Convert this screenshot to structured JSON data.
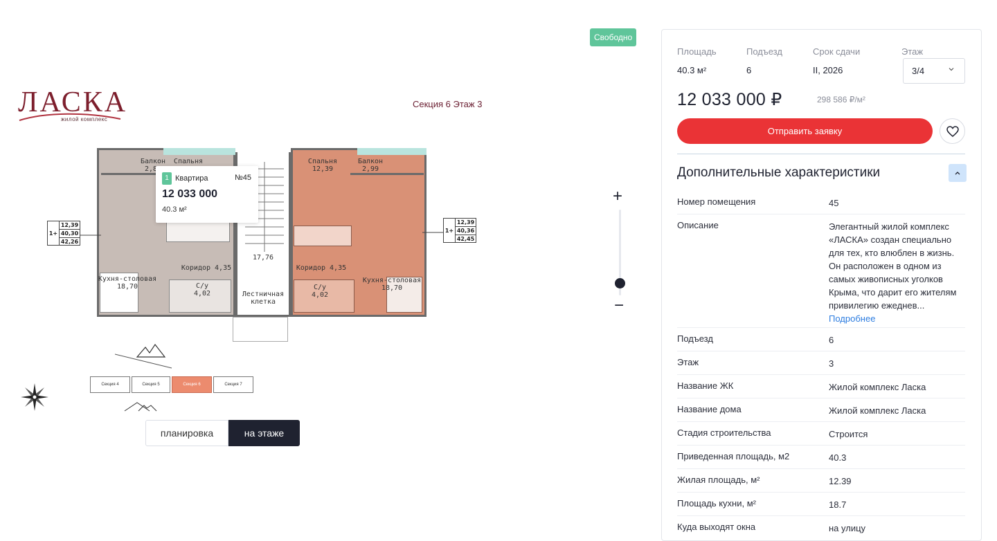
{
  "status": "Свободно",
  "logo": {
    "name": "ЛАСКА",
    "subtitle": "жилой комплекс"
  },
  "section_label": "Секция 6 Этаж 3",
  "plan": {
    "rooms_left": {
      "balcony": "Балкон\n2,80",
      "bedroom": "Спальня",
      "corridor": "Коридор 4,35",
      "kitchen": "Кухня-столовая\n18,70",
      "bath": "С/у\n4,02"
    },
    "rooms_center": {
      "hall_area": "17,76",
      "stairs": "Лестничная\nклетка"
    },
    "rooms_right": {
      "bedroom": "Спальня\n12,39",
      "balcony": "Балкон\n2,99",
      "corridor": "Коридор 4,35",
      "kitchen": "Кухня-столовая\n18,70",
      "bath": "С/у\n4,02"
    },
    "tag_left": {
      "rooms": "1+",
      "values": [
        "12,39",
        "40,30",
        "42,26"
      ]
    },
    "tag_right": {
      "rooms": "1+",
      "values": [
        "12,39",
        "40,36",
        "42,45"
      ]
    }
  },
  "popover": {
    "rooms": "1",
    "type": "Квартира",
    "number": "№45",
    "price": "12 033 000",
    "area": "40.3 м²"
  },
  "zoom": {
    "plus": "+",
    "minus": "−",
    "level": 0.18
  },
  "sections": [
    {
      "label": "Секция 4",
      "active": false
    },
    {
      "label": "Секция 5",
      "active": false
    },
    {
      "label": "Секция 6",
      "active": true
    },
    {
      "label": "Секция 7",
      "active": false
    }
  ],
  "view_toggle": {
    "plan": "планировка",
    "floor": "на этаже"
  },
  "panel": {
    "meta": [
      {
        "label": "Площадь",
        "value": "40.3 м²"
      },
      {
        "label": "Подъезд",
        "value": "6"
      },
      {
        "label": "Срок сдачи",
        "value": "II, 2026"
      },
      {
        "label": "Этаж",
        "value": "3/4"
      }
    ],
    "price": "12 033 000 ₽",
    "price_per_m2": "298 586 ₽/м²",
    "cta": "Отправить заявку",
    "additional_title": "Дополнительные характеристики",
    "characteristics": [
      {
        "key": "Номер помещения",
        "value": "45"
      },
      {
        "key": "Описание",
        "value": "Элегантный жилой комплекс «ЛАСКА» создан специально для тех, кто влюблен в жизнь. Он расположен в одном из самых живописных уголков Крыма, что дарит его жителям привилегию ежеднев...",
        "more": "Подробнее"
      },
      {
        "key": "Подъезд",
        "value": "6"
      },
      {
        "key": "Этаж",
        "value": "3"
      },
      {
        "key": "Название ЖК",
        "value": "Жилой комплекс Ласка"
      },
      {
        "key": "Название дома",
        "value": "Жилой комплекс Ласка"
      },
      {
        "key": "Стадия строительства",
        "value": "Строится"
      },
      {
        "key": "Приведенная площадь, м2",
        "value": "40.3"
      },
      {
        "key": "Жилая площадь, м²",
        "value": "12.39"
      },
      {
        "key": "Площадь кухни, м²",
        "value": "18.7"
      },
      {
        "key": "Куда выходят окна",
        "value": "на улицу"
      }
    ]
  },
  "colors": {
    "accent_red": "#ea3336",
    "status_green": "#5fc59a",
    "brand_maroon": "#7d1f2d",
    "highlight_salmon": "#ec8b6e",
    "dark": "#1f2230"
  }
}
